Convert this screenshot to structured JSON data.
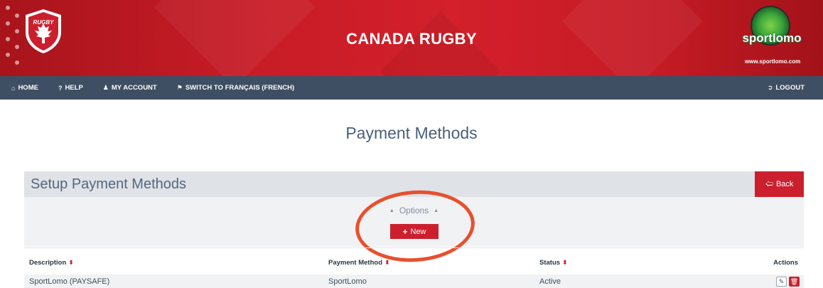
{
  "header": {
    "site_title": "CANADA RUGBY",
    "crest_text": "RUGBY",
    "sponsor_logo_text": "sportlomo",
    "sponsor_url": "www.sportlomo.com",
    "brand_color": "#cc1f2d"
  },
  "nav": {
    "items": [
      {
        "icon": "home-icon",
        "label": "HOME"
      },
      {
        "icon": "help-icon",
        "label": "HELP"
      },
      {
        "icon": "user-icon",
        "label": "MY ACCOUNT"
      },
      {
        "icon": "flag-icon",
        "label": "SWITCH TO FRANÇAIS (FRENCH)"
      }
    ],
    "logout": {
      "icon": "logout-icon",
      "label": "LOGOUT"
    }
  },
  "page": {
    "title": "Payment Methods"
  },
  "panel": {
    "title": "Setup Payment Methods",
    "back_label": "Back",
    "options_label": "Options",
    "new_label": "New"
  },
  "table": {
    "columns": [
      "Description",
      "Payment Method",
      "Status",
      "Actions"
    ],
    "rows": [
      {
        "description": "SportLomo (PAYSAFE)",
        "payment_method": "SportLomo",
        "status": "Active"
      }
    ]
  }
}
